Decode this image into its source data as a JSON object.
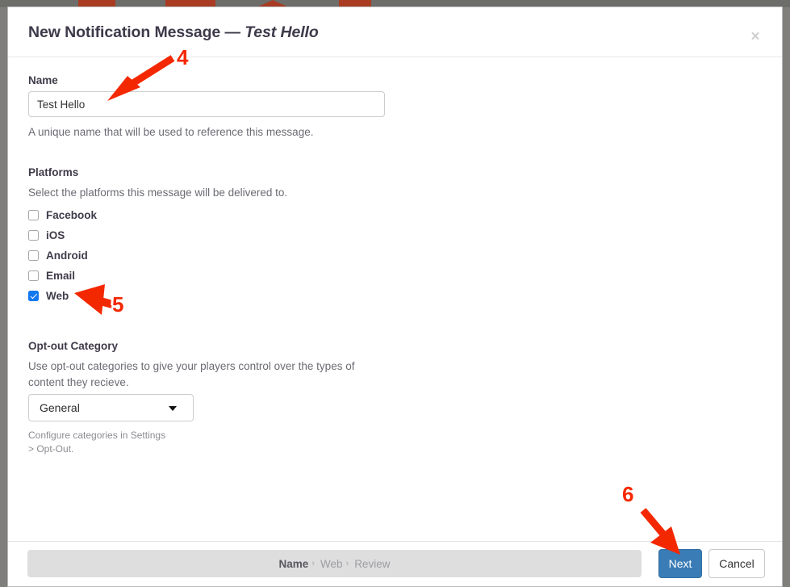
{
  "dialog": {
    "title_main": "New Notification Message",
    "title_dash": "—",
    "title_subject": "Test Hello",
    "close_label": "×"
  },
  "name_field": {
    "label": "Name",
    "value": "Test Hello",
    "placeholder": "Name",
    "help": "A unique name that will be used to reference this message."
  },
  "platforms": {
    "label": "Platforms",
    "help": "Select the platforms this message will be delivered to.",
    "items": [
      {
        "label": "Facebook",
        "checked": false
      },
      {
        "label": "iOS",
        "checked": false
      },
      {
        "label": "Android",
        "checked": false
      },
      {
        "label": "Email",
        "checked": false
      },
      {
        "label": "Web",
        "checked": true
      }
    ]
  },
  "optout": {
    "label": "Opt-out Category",
    "help": "Use opt-out categories to give your players control over the types of content they recieve.",
    "selected": "General",
    "options": [
      "General"
    ],
    "footnote": "Configure categories in Settings > Opt-Out."
  },
  "footer": {
    "breadcrumb": [
      {
        "label": "Name",
        "active": true
      },
      {
        "label": "Web",
        "active": false
      },
      {
        "label": "Review",
        "active": false
      }
    ],
    "separator": "›",
    "next_label": "Next",
    "cancel_label": "Cancel"
  },
  "annotations": [
    {
      "number": "4"
    },
    {
      "number": "5"
    },
    {
      "number": "6"
    }
  ],
  "colors": {
    "accent_blue": "#3a7cb5",
    "checkbox_blue": "#1178f0",
    "annotation_red": "#f42800",
    "title_text": "#3f3a4a"
  }
}
